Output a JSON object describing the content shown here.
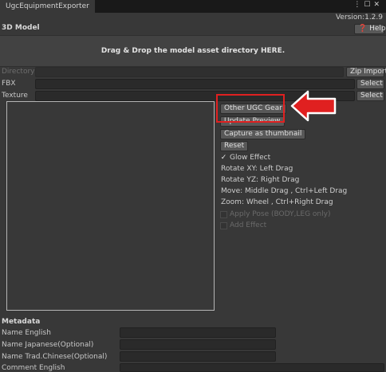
{
  "window": {
    "tab_title": "UgcEquipmentExporter",
    "menu_icon": "more-vert-icon",
    "maximize_icon": "maximize-icon",
    "version": "Version:1.2.9"
  },
  "model_section": {
    "title": "3D Model",
    "help_label": "Help",
    "help_icon": "help-icon",
    "drop_hint": "Drag & Drop the model asset directory HERE."
  },
  "fields": {
    "directory": {
      "label": "Directory",
      "value": "",
      "button": "Zip Import"
    },
    "fbx": {
      "label": "FBX",
      "value": "",
      "button": "Select"
    },
    "texture": {
      "label": "Texture",
      "value": "",
      "button": "Select"
    }
  },
  "preview_controls": {
    "other_gear_button": "Other UGC Gear",
    "update_preview_button": "Update Preview",
    "capture_button": "Capture as thumbnail",
    "reset_button": "Reset",
    "glow_effect": {
      "label": "Glow Effect",
      "checked": true
    },
    "hints": [
      "Rotate XY: Left Drag",
      "Rotate YZ: Right Drag",
      "Move: Middle Drag , Ctrl+Left Drag",
      "Zoom: Wheel , Ctrl+Right Drag"
    ],
    "apply_pose": {
      "label": "Apply Pose (BODY,LEG only)",
      "checked": false
    },
    "add_effect": {
      "label": "Add Effect",
      "checked": false
    }
  },
  "metadata": {
    "title": "Metadata",
    "rows": [
      {
        "label": "Name English",
        "value": ""
      },
      {
        "label": "Name Japanese(Optional)",
        "value": ""
      },
      {
        "label": "Name Trad.Chinese(Optional)",
        "value": ""
      },
      {
        "label": "Comment English",
        "value": ""
      }
    ]
  },
  "annotation": {
    "highlight_color": "#e02020",
    "arrow_color": "#e02020"
  }
}
